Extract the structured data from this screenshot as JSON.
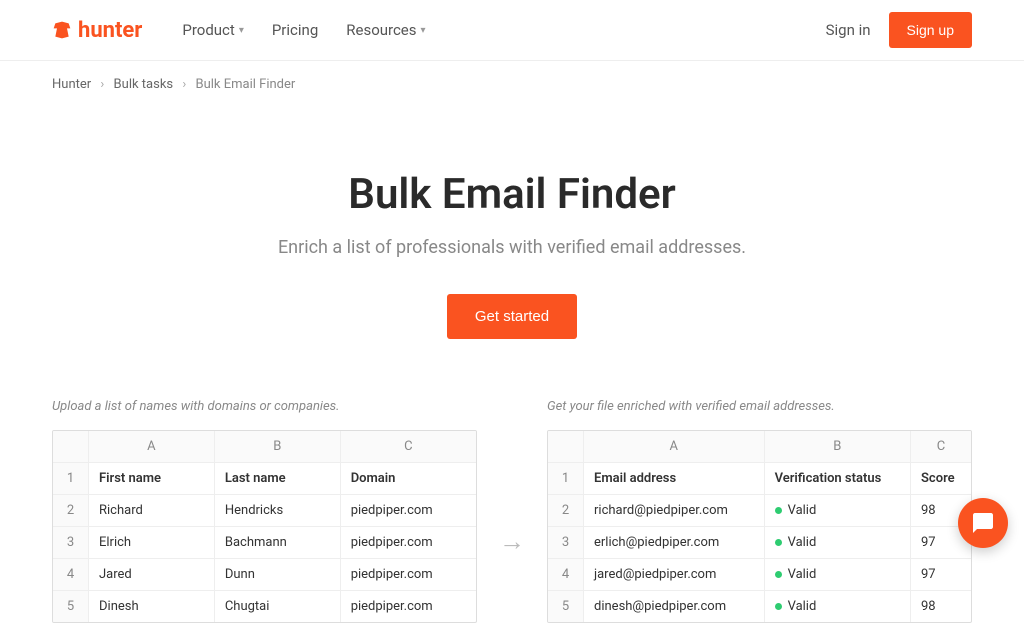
{
  "header": {
    "logo_text": "hunter",
    "nav": {
      "product": "Product",
      "pricing": "Pricing",
      "resources": "Resources"
    },
    "sign_in": "Sign in",
    "sign_up": "Sign up"
  },
  "breadcrumb": {
    "item0": "Hunter",
    "item1": "Bulk tasks",
    "item2": "Bulk Email Finder"
  },
  "hero": {
    "title": "Bulk Email Finder",
    "subtitle": "Enrich a list of professionals with verified email addresses.",
    "cta": "Get started"
  },
  "panels": {
    "left_caption": "Upload a list of names with domains or companies.",
    "right_caption": "Get your file enriched with verified email addresses."
  },
  "sheet_cols": {
    "a": "A",
    "b": "B",
    "c": "C"
  },
  "left_sheet": {
    "h_a": "First name",
    "h_b": "Last name",
    "h_c": "Domain",
    "r2": {
      "n": "2",
      "a": "Richard",
      "b": "Hendricks",
      "c": "piedpiper.com"
    },
    "r3": {
      "n": "3",
      "a": "Elrich",
      "b": "Bachmann",
      "c": "piedpiper.com"
    },
    "r4": {
      "n": "4",
      "a": "Jared",
      "b": "Dunn",
      "c": "piedpiper.com"
    },
    "r5": {
      "n": "5",
      "a": "Dinesh",
      "b": "Chugtai",
      "c": "piedpiper.com"
    }
  },
  "right_sheet": {
    "h_a": "Email address",
    "h_b": "Verification status",
    "h_c": "Score",
    "r2": {
      "n": "2",
      "a": "richard@piedpiper.com",
      "b": "Valid",
      "c": "98"
    },
    "r3": {
      "n": "3",
      "a": "erlich@piedpiper.com",
      "b": "Valid",
      "c": "97"
    },
    "r4": {
      "n": "4",
      "a": "jared@piedpiper.com",
      "b": "Valid",
      "c": "97"
    },
    "r5": {
      "n": "5",
      "a": "dinesh@piedpiper.com",
      "b": "Valid",
      "c": "98"
    }
  },
  "row1": "1"
}
